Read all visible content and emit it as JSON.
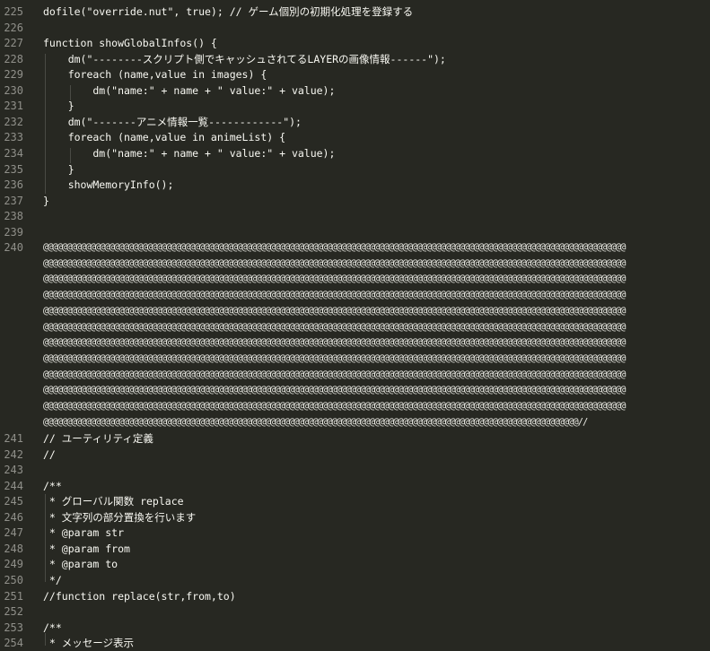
{
  "editor": {
    "lines": [
      {
        "n": "225",
        "text": "dofile(\"override.nut\", true); // ゲーム個別の初期化処理を登録する"
      },
      {
        "n": "226",
        "text": ""
      },
      {
        "n": "227",
        "text": "function showGlobalInfos() {"
      },
      {
        "n": "228",
        "text": "    dm(\"--------スクリプト側でキャッシュされてるLAYERの画像情報------\");"
      },
      {
        "n": "229",
        "text": "    foreach (name,value in images) {"
      },
      {
        "n": "230",
        "text": "        dm(\"name:\" + name + \" value:\" + value);"
      },
      {
        "n": "231",
        "text": "    }"
      },
      {
        "n": "232",
        "text": "    dm(\"-------アニメ情報一覧------------\");"
      },
      {
        "n": "233",
        "text": "    foreach (name,value in animeList) {"
      },
      {
        "n": "234",
        "text": "        dm(\"name:\" + name + \" value:\" + value);"
      },
      {
        "n": "235",
        "text": "    }"
      },
      {
        "n": "236",
        "text": "    showMemoryInfo();"
      },
      {
        "n": "237",
        "text": "}"
      },
      {
        "n": "238",
        "text": ""
      },
      {
        "n": "239",
        "text": ""
      },
      {
        "n": "240",
        "text": ""
      },
      {
        "n": "241",
        "text": "// ユーティリティ定義"
      },
      {
        "n": "242",
        "text": "//"
      },
      {
        "n": "243",
        "text": ""
      },
      {
        "n": "244",
        "text": "/**"
      },
      {
        "n": "245",
        "text": " * グローバル関数 replace"
      },
      {
        "n": "246",
        "text": " * 文字列の部分置換を行います"
      },
      {
        "n": "247",
        "text": " * @param str"
      },
      {
        "n": "248",
        "text": " * @param from"
      },
      {
        "n": "249",
        "text": " * @param to"
      },
      {
        "n": "250",
        "text": " */"
      },
      {
        "n": "251",
        "text": "//function replace(str,from,to)"
      },
      {
        "n": "252",
        "text": ""
      },
      {
        "n": "253",
        "text": "/**"
      },
      {
        "n": "254",
        "text": " * メッセージ表示"
      }
    ],
    "wrapped_rows": [
      "@@@@@@@@@@@@@@@@@@@@@@@@@@@@@@@@@@@@@@@@@@@@@@@@@@@@@@@@@@@@@@@@@@@@@@@@@@@@@@@@@@@@@@@@@@@@@@@@@@@@@@@@@@@@@@@@@@@@@@@@@@@",
      "@@@@@@@@@@@@@@@@@@@@@@@@@@@@@@@@@@@@@@@@@@@@@@@@@@@@@@@@@@@@@@@@@@@@@@@@@@@@@@@@@@@@@@@@@@@@@@@@@@@@@@@@@@@@@@@@@@@@@@@@@@@",
      "@@@@@@@@@@@@@@@@@@@@@@@@@@@@@@@@@@@@@@@@@@@@@@@@@@@@@@@@@@@@@@@@@@@@@@@@@@@@@@@@@@@@@@@@@@@@@@@@@@@@@@@@@@@@@@@@@@@@@@@@@@@",
      "@@@@@@@@@@@@@@@@@@@@@@@@@@@@@@@@@@@@@@@@@@@@@@@@@@@@@@@@@@@@@@@@@@@@@@@@@@@@@@@@@@@@@@@@@@@@@@@@@@@@@@@@@@@@@@@@@@@@@@@@@@@",
      "@@@@@@@@@@@@@@@@@@@@@@@@@@@@@@@@@@@@@@@@@@@@@@@@@@@@@@@@@@@@@@@@@@@@@@@@@@@@@@@@@@@@@@@@@@@@@@@@@@@@@@@@@@@@@@@@@@@@@@@@@@@",
      "@@@@@@@@@@@@@@@@@@@@@@@@@@@@@@@@@@@@@@@@@@@@@@@@@@@@@@@@@@@@@@@@@@@@@@@@@@@@@@@@@@@@@@@@@@@@@@@@@@@@@@@@@@@@@@@@@@@@@@@@@@@",
      "@@@@@@@@@@@@@@@@@@@@@@@@@@@@@@@@@@@@@@@@@@@@@@@@@@@@@@@@@@@@@@@@@@@@@@@@@@@@@@@@@@@@@@@@@@@@@@@@@@@@@@@@@@@@@@@@@@@@@@@@@@@",
      "@@@@@@@@@@@@@@@@@@@@@@@@@@@@@@@@@@@@@@@@@@@@@@@@@@@@@@@@@@@@@@@@@@@@@@@@@@@@@@@@@@@@@@@@@@@@@@@@@@@@@@@@@@@@@@@@@@@@@@@@@@@",
      "@@@@@@@@@@@@@@@@@@@@@@@@@@@@@@@@@@@@@@@@@@@@@@@@@@@@@@@@@@@@@@@@@@@@@@@@@@@@@@@@@@@@@@@@@@@@@@@@@@@@@@@@@@@@@@@@@@@@@@@@@@@",
      "@@@@@@@@@@@@@@@@@@@@@@@@@@@@@@@@@@@@@@@@@@@@@@@@@@@@@@@@@@@@@@@@@@@@@@@@@@@@@@@@@@@@@@@@@@@@@@@@@@@@@@@@@@@@@@@@@@@@@@@@@@@",
      "@@@@@@@@@@@@@@@@@@@@@@@@@@@@@@@@@@@@@@@@@@@@@@@@@@@@@@@@@@@@@@@@@@@@@@@@@@@@@@@@@@@@@@@@@@@@@@@@@@@@@@@@@@@@@@@@@@@@@@@@@@@",
      "@@@@@@@@@@@@@@@@@@@@@@@@@@@@@@@@@@@@@@@@@@@@@@@@@@@@@@@@@@@@@@@@@@@@@@@@@@@@@@@@@@@@@@@@@@@@@@@@@@@@@@@@@@@@@@@@@//"
    ]
  }
}
